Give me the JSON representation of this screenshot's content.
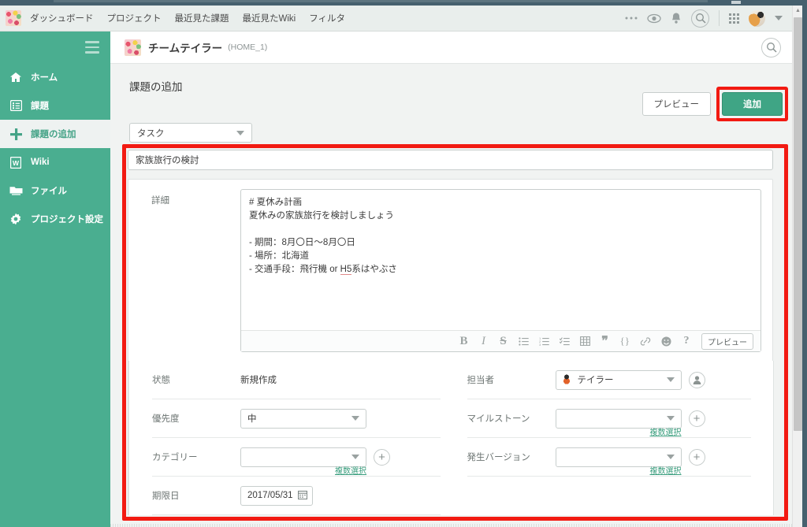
{
  "topnav": {
    "avatar_name": "user-avatar",
    "links": [
      "ダッシュボード",
      "プロジェクト",
      "最近見た課題",
      "最近見たWiki",
      "フィルタ"
    ],
    "icons": [
      "ellipsis-icon",
      "eye-icon",
      "bell-icon",
      "search-icon",
      "apps-grid-icon",
      "account-avatar",
      "chevron-down-icon"
    ]
  },
  "sidebar": {
    "menu_icon": "hamburger-menu-icon",
    "items": [
      {
        "label": "ホーム",
        "icon": "home-icon",
        "active": false
      },
      {
        "label": "課題",
        "icon": "list-icon",
        "active": false
      },
      {
        "label": "課題の追加",
        "icon": "plus-icon",
        "active": true
      },
      {
        "label": "Wiki",
        "icon": "wiki-icon",
        "active": false
      },
      {
        "label": "ファイル",
        "icon": "folder-icon",
        "active": false
      },
      {
        "label": "プロジェクト設定",
        "icon": "gear-icon",
        "active": false
      }
    ]
  },
  "project_header": {
    "name": "チームテイラー",
    "key": "(HOME_1)",
    "search_icon": "search-icon"
  },
  "page": {
    "title": "課題の追加",
    "issue_type": "タスク"
  },
  "actions": {
    "preview_label": "プレビュー",
    "add_label": "追加"
  },
  "form": {
    "subject_value": "家族旅行の検討",
    "description_label": "詳細",
    "description_value_line1": "# 夏休み計画",
    "description_value_line2": "夏休みの家族旅行を検討しましょう",
    "description_value_line3": "",
    "description_value_line4": "- 期間：8月〇日〜8月〇日",
    "description_value_line5": "- 場所：北海道",
    "description_value_line6_a": "- 交通手段：飛行機 or ",
    "description_value_line6_b": "H5",
    "description_value_line6_c": "系はやぶさ",
    "toolbar": {
      "bold": "B",
      "italic": "I",
      "strike": "S",
      "bullet_list": "☰",
      "number_list": "≡",
      "check_list": "☑",
      "table": "⊞",
      "quote": "❞",
      "code": "{}",
      "link": "🔗",
      "emoji": "☺",
      "help": "?",
      "preview_label": "プレビュー"
    },
    "left_fields": [
      {
        "label": "状態",
        "type": "static",
        "value": "新規作成"
      },
      {
        "label": "優先度",
        "type": "select",
        "value": "中",
        "multi": null,
        "plus": false
      },
      {
        "label": "カテゴリー",
        "type": "select",
        "value": "",
        "multi": "複数選択",
        "plus": true
      },
      {
        "label": "期限日",
        "type": "date",
        "value": "2017/05/31",
        "multi": null,
        "plus": false
      }
    ],
    "right_fields": [
      {
        "label": "担当者",
        "type": "select-avatar",
        "value": "テイラー",
        "multi": null,
        "self": true
      },
      {
        "label": "マイルストーン",
        "type": "select",
        "value": "",
        "multi": "複数選択",
        "plus": true
      },
      {
        "label": "発生バージョン",
        "type": "select",
        "value": "",
        "multi": "複数選択",
        "plus": true
      }
    ]
  },
  "colors": {
    "sidebar_green": "#4aae90",
    "accent_green": "#3fa585",
    "annotation_red": "#f21a12",
    "link_green": "#3a9e7e"
  }
}
